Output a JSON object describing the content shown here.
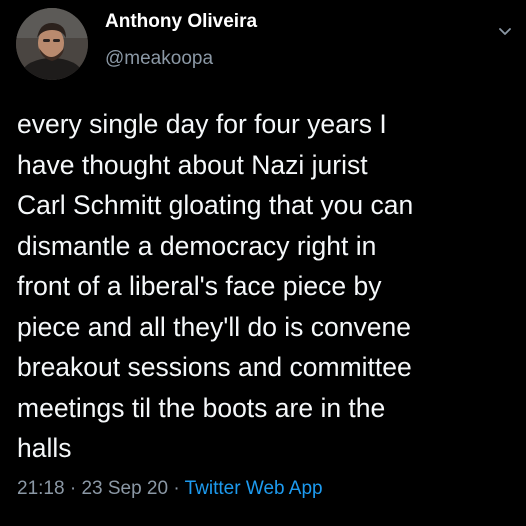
{
  "tweet": {
    "author": {
      "display_name": "Anthony Oliveira",
      "handle": "@meakoopa"
    },
    "text_lines": [
      "every single day for four years I",
      "have thought about Nazi jurist",
      "Carl Schmitt gloating that you can",
      "dismantle a democracy right in",
      "front of a liberal's face piece by",
      "piece and all they'll do is convene",
      "breakout sessions and committee",
      "meetings til the boots are in the",
      "halls"
    ],
    "time": "21:18",
    "date": "23 Sep 20",
    "separator": "·",
    "source_app": "Twitter Web App"
  },
  "icons": {
    "more_options": "chevron-down-icon",
    "avatar": "avatar"
  },
  "colors": {
    "background": "#000000",
    "text": "#f5f8fa",
    "secondary_text": "#8b98a5",
    "link": "#1d9bf0"
  }
}
